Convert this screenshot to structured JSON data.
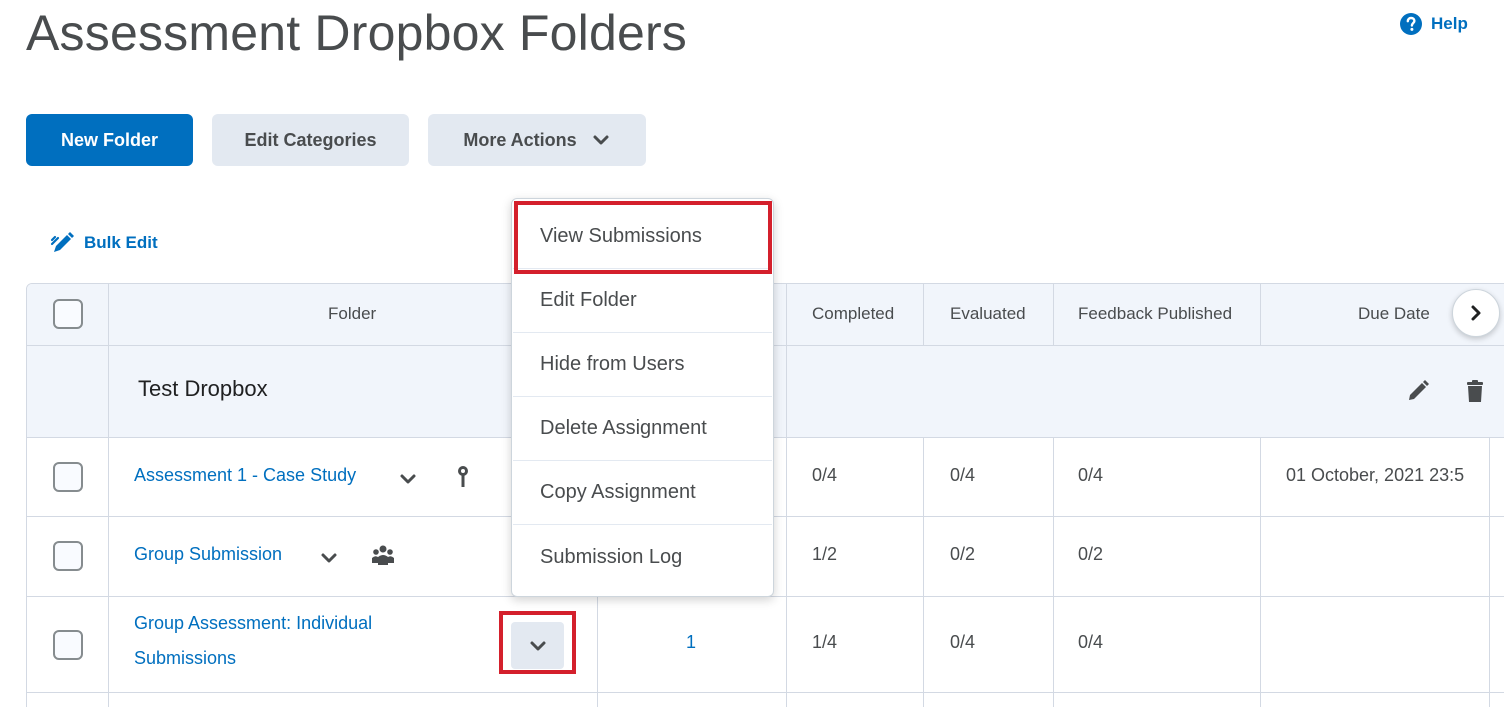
{
  "page": {
    "title": "Assessment Dropbox Folders",
    "help_label": "Help"
  },
  "toolbar": {
    "new_folder": "New Folder",
    "edit_categories": "Edit Categories",
    "more_actions": "More Actions"
  },
  "bulk_edit": "Bulk Edit",
  "table": {
    "headers": {
      "folder": "Folder",
      "completed": "Completed",
      "evaluated": "Evaluated",
      "feedback_published": "Feedback Published",
      "due_date": "Due Date"
    },
    "category": {
      "name": "Test Dropbox"
    },
    "rows": [
      {
        "folder": "Assessment 1 - Case Study",
        "icon": "key-icon",
        "completed": "0/4",
        "evaluated": "0/4",
        "feedback_published": "0/4",
        "due_date": "01 October, 2021 23:5"
      },
      {
        "folder": "Group Submission",
        "icon": "group-icon",
        "completed": "1/2",
        "evaluated": "0/2",
        "feedback_published": "0/2",
        "due_date": ""
      },
      {
        "folder_line1": "Group Assessment: Individual",
        "folder_line2": "Submissions",
        "new_submissions": "1",
        "completed": "1/4",
        "evaluated": "0/4",
        "feedback_published": "0/4",
        "due_date": ""
      }
    ]
  },
  "context_menu": {
    "items": [
      "View Submissions",
      "Edit Folder",
      "Hide from Users",
      "Delete Assignment",
      "Copy Assignment",
      "Submission Log"
    ]
  },
  "colors": {
    "primary": "#006fbf",
    "secondary_bg": "#e3e9f1",
    "highlight": "#d4202c",
    "header_bg": "#f1f5fb",
    "border": "#d3d9e3"
  }
}
